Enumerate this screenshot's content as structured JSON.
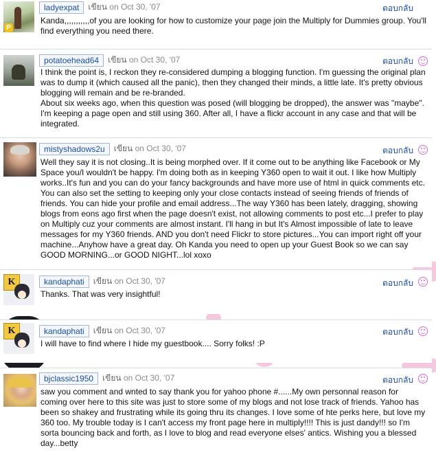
{
  "reply_label": "ตอบกลับ",
  "said_label": "เขียน",
  "comments": [
    {
      "author": "ladyexpat",
      "date": "on Oct 30, '07",
      "text": [
        "Kanda,,,,,,,,,,,of you are looking for how to customize your page join the Multiply for Dummies group. You'll find everything you need there."
      ]
    },
    {
      "author": "potatoehead64",
      "date": "on Oct 30, '07",
      "text": [
        "I think the point is, I reckon they re-considered dumping a blogging function. I'm guessing the original plan was to dump it (which caused all the panic), then they changed their minds, a little late. It's pretty obvious blogging will remain and be re-branded.",
        "About six weeks ago, when this question was posed (will blogging be dropped), the answer was \"maybe\". I'm keeping a page open and still using 360. After all, I have a flickr account in any case and that will be integrated."
      ]
    },
    {
      "author": "mistyshadows2u",
      "date": "on Oct 30, '07",
      "text": [
        "Well they say it is not closing..It is being morphed over. If it come out to be anything like Facebook or My Space you/I wouldn't be happy. I'm doing both as in keeping Y360 open to wait it out. I like how Multiply works..It's fun and you can do your fancy backgrounds and have more use of html in quick comments etc. You can also set the setting to keeping only your close contacts instead of seeing friends of friends of friends. You can hide your profile and email address...The way Y360 has been lately, dragging, showing blogs from eons ago first when the page doesn't exist, not allowing comments to post etc...I prefer to play on Multiply cuz your comments are almost instant. I'll hang in but It's Almost impossible of late to leave messages for my Y360 friends. AND you don't need Flickr to store pictures...You can import right off your machine...Anyhow have a great day. Oh Kanda you need to open up your Guest Book so we can say GOOD MORNING...or GOOD NIGHT...lol xoxo"
      ]
    },
    {
      "author": "kandaphati",
      "date": "on Oct 30, '07",
      "text": [
        "Thanks. That was very insightful!"
      ]
    },
    {
      "author": "kandaphati",
      "date": "on Oct 30, '07",
      "text": [
        "I will have to find where I hide my guestbook.... Sorry folks! :P"
      ]
    },
    {
      "author": "bjclassic1950",
      "date": "on Oct 30, '07",
      "text": [
        "saw you comment and wnted to say thank you for yahoo phone #......My own personnal reason for coming over here to this site was just to store some of my blogs and not lose track of friends. Yahoo has been so shakey and frustrating while its going thru its changes. I love some of hte perks here, but love my 360 too. My trouble today is I can't access my front page here in multiply!!!! This is just dandy!!! so I'm sorta bouncing back and forth, as I love to blog and read everyone elses' antics. Wishing you a blessed day...betty"
      ]
    }
  ]
}
